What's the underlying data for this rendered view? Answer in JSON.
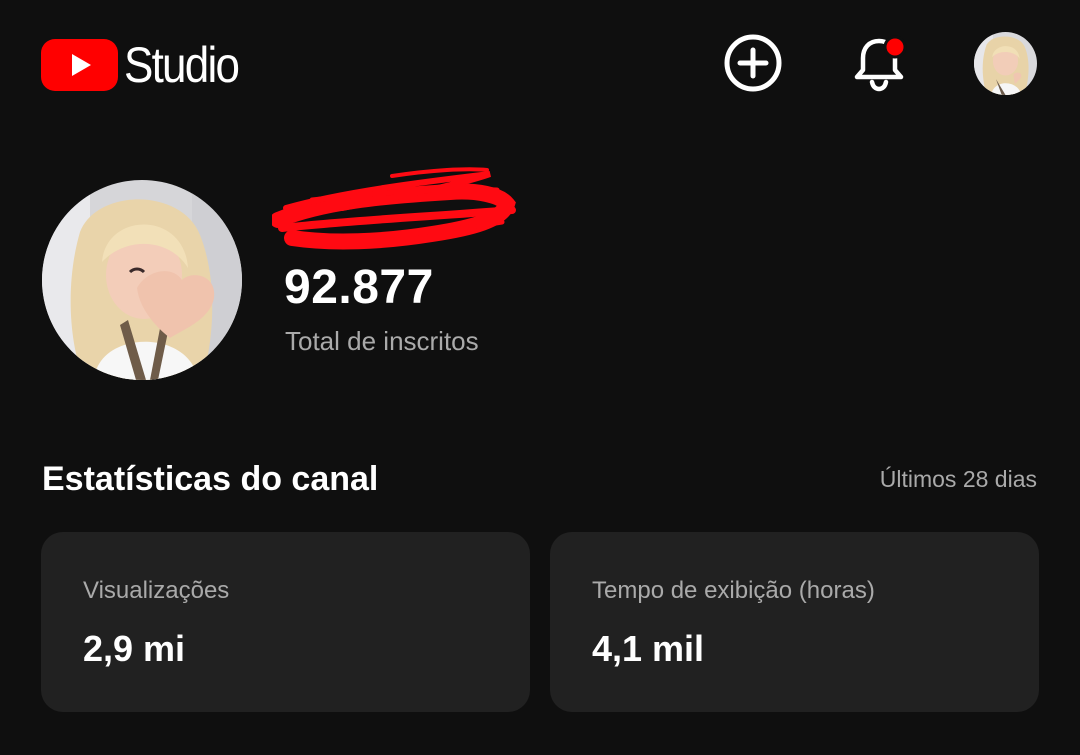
{
  "header": {
    "app_name": "Studio",
    "brand_color": "#ff0000",
    "notification_dot_color": "#ff0000",
    "icons": [
      "youtube-play-icon",
      "create-plus-icon",
      "bell-icon"
    ]
  },
  "channel": {
    "subscriber_count": "92.877",
    "subscriber_label": "Total de inscritos"
  },
  "stats": {
    "title": "Estatísticas do canal",
    "period": "Últimos 28 dias",
    "cards": [
      {
        "label": "Visualizações",
        "value": "2,9 mi"
      },
      {
        "label": "Tempo de exibição (horas)",
        "value": "4,1 mil"
      }
    ]
  }
}
